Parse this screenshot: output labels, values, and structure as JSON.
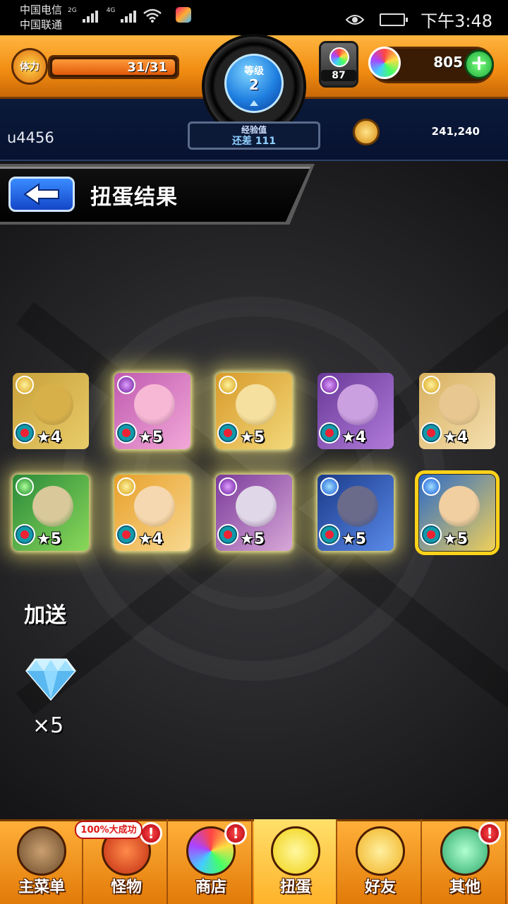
{
  "status_bar": {
    "carrier_1": "中国电信",
    "carrier_2": "中国联通",
    "network_1": "2G",
    "network_2": "4G",
    "time": "下午3:48"
  },
  "hud": {
    "stamina_label": "体力",
    "stamina_text": "31/31",
    "stamina_fraction": 1.0,
    "level_label": "等级",
    "level_value": "2",
    "exp_label": "经验值",
    "exp_value": "还差 111",
    "orb_pack_count": "87",
    "gem_count": "805",
    "username": "u4456",
    "coins": "241,240"
  },
  "header": {
    "title": "扭蛋结果"
  },
  "results": [
    {
      "stars": "★4",
      "attr": "light",
      "glow": false,
      "selected": false,
      "art": [
        "#c9a13a",
        "#e8cc6a"
      ],
      "face": "#d8b04a"
    },
    {
      "stars": "★5",
      "attr": "dark",
      "glow": true,
      "selected": false,
      "art": [
        "#c05ab0",
        "#f2a8d8"
      ],
      "face": "#f6b8d4"
    },
    {
      "stars": "★5",
      "attr": "light",
      "glow": true,
      "selected": false,
      "art": [
        "#d89a2a",
        "#f2d87a"
      ],
      "face": "#f6e0a0"
    },
    {
      "stars": "★4",
      "attr": "dark",
      "glow": false,
      "selected": false,
      "art": [
        "#6a3a9a",
        "#b07ad8"
      ],
      "face": "#caa0e0"
    },
    {
      "stars": "★4",
      "attr": "light",
      "glow": false,
      "selected": false,
      "art": [
        "#d8b060",
        "#f4e0b0"
      ],
      "face": "#e8c890"
    },
    {
      "stars": "★5",
      "attr": "wood",
      "glow": true,
      "selected": false,
      "art": [
        "#2a8a3a",
        "#8ad85a"
      ],
      "face": "#d8c89a"
    },
    {
      "stars": "★4",
      "attr": "light",
      "glow": true,
      "selected": false,
      "art": [
        "#e8a02a",
        "#f8d890"
      ],
      "face": "#f6d8b0"
    },
    {
      "stars": "★5",
      "attr": "dark",
      "glow": true,
      "selected": false,
      "art": [
        "#7a3a9a",
        "#d8a8d8"
      ],
      "face": "#e0d8e8"
    },
    {
      "stars": "★5",
      "attr": "water",
      "glow": true,
      "selected": false,
      "art": [
        "#1a3a8a",
        "#5a8ae8"
      ],
      "face": "#6a6a8a"
    },
    {
      "stars": "★5",
      "attr": "water",
      "glow": false,
      "selected": true,
      "art": [
        "#2a6ac8",
        "#f0d05a"
      ],
      "face": "#f2cfa0"
    }
  ],
  "bonus": {
    "title": "加送",
    "quantity": "×5"
  },
  "nav": [
    {
      "label": "主菜单",
      "icon": "gate-icon",
      "alert": false,
      "active": false
    },
    {
      "label": "怪物",
      "icon": "dragon-icon",
      "alert": true,
      "active": false
    },
    {
      "label": "商店",
      "icon": "rainbow-orb-icon",
      "alert": true,
      "active": false
    },
    {
      "label": "扭蛋",
      "icon": "egg-icon",
      "alert": false,
      "active": true
    },
    {
      "label": "好友",
      "icon": "friends-icon",
      "alert": false,
      "active": false
    },
    {
      "label": "其他",
      "icon": "question-icon",
      "alert": true,
      "active": false
    }
  ],
  "nav_promo": "100%大成功",
  "alert_symbol": "!",
  "colors": {
    "orange": "#f08a10",
    "navy": "#071230",
    "highlight": "#ffd21a"
  }
}
